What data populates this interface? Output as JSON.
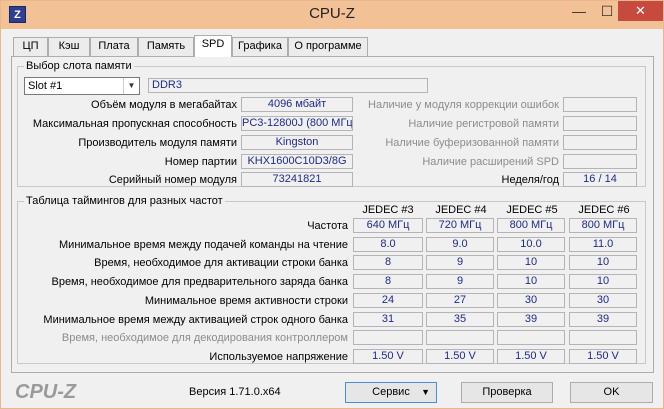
{
  "window": {
    "icon_letter": "Z",
    "title": "CPU-Z",
    "min_glyph": "—",
    "max_glyph": "☐",
    "close_glyph": "✕"
  },
  "tabs": [
    {
      "label": "ЦП"
    },
    {
      "label": "Кэш"
    },
    {
      "label": "Плата"
    },
    {
      "label": "Память"
    },
    {
      "label": "SPD",
      "active": true
    },
    {
      "label": "Графика"
    },
    {
      "label": "О программе"
    }
  ],
  "slot": {
    "group_title": "Выбор слота памяти",
    "selected": "Slot #1",
    "type": "DDR3",
    "fields": [
      {
        "label": "Объём модуля в мегабайтах",
        "value": "4096 мбайт"
      },
      {
        "label": "Максимальная пропускная способность",
        "value": "PC3-12800J (800 МГц)"
      },
      {
        "label": "Производитель модуля памяти",
        "value": "Kingston"
      },
      {
        "label": "Номер партии",
        "value": "KHX1600C10D3/8G"
      },
      {
        "label": "Серийный номер модуля",
        "value": "73241821"
      }
    ],
    "right_fields": [
      {
        "label": "Наличие у модуля коррекции ошибок",
        "value": ""
      },
      {
        "label": "Наличие регистровой памяти",
        "value": ""
      },
      {
        "label": "Наличие буферизованной памяти",
        "value": ""
      },
      {
        "label": "Наличие расширений SPD",
        "value": ""
      }
    ],
    "week_year_label": "Неделя/год",
    "week_year": "16 / 14"
  },
  "timings": {
    "group_title": "Таблица таймингов для разных частот",
    "columns": [
      "JEDEC #3",
      "JEDEC #4",
      "JEDEC #5",
      "JEDEC #6"
    ],
    "rows": [
      {
        "label": "Частота",
        "values": [
          "640 МГц",
          "720 МГц",
          "800 МГц",
          "800 МГц"
        ],
        "disabled": false
      },
      {
        "label": "Минимальное время между подачей команды на чтение",
        "values": [
          "8.0",
          "9.0",
          "10.0",
          "11.0"
        ],
        "disabled": false
      },
      {
        "label": "Время, необходимое для активации строки банка",
        "values": [
          "8",
          "9",
          "10",
          "10"
        ],
        "disabled": false
      },
      {
        "label": "Время, необходимое для предварительного заряда банка",
        "values": [
          "8",
          "9",
          "10",
          "10"
        ],
        "disabled": false
      },
      {
        "label": "Минимальное время активности строки",
        "values": [
          "24",
          "27",
          "30",
          "30"
        ],
        "disabled": false
      },
      {
        "label": "Минимальное время между активацией строк одного банка",
        "values": [
          "31",
          "35",
          "39",
          "39"
        ],
        "disabled": false
      },
      {
        "label": "Время, необходимое для декодирования контроллером",
        "values": [
          "",
          "",
          "",
          ""
        ],
        "disabled": true
      },
      {
        "label": "Используемое напряжение",
        "values": [
          "1.50 V",
          "1.50 V",
          "1.50 V",
          "1.50 V"
        ],
        "disabled": false
      }
    ]
  },
  "footer": {
    "logo": "CPU-Z",
    "version": "Версия 1.71.0.x64",
    "service_label": "Сервис",
    "check_label": "Проверка",
    "ok_label": "OK"
  }
}
